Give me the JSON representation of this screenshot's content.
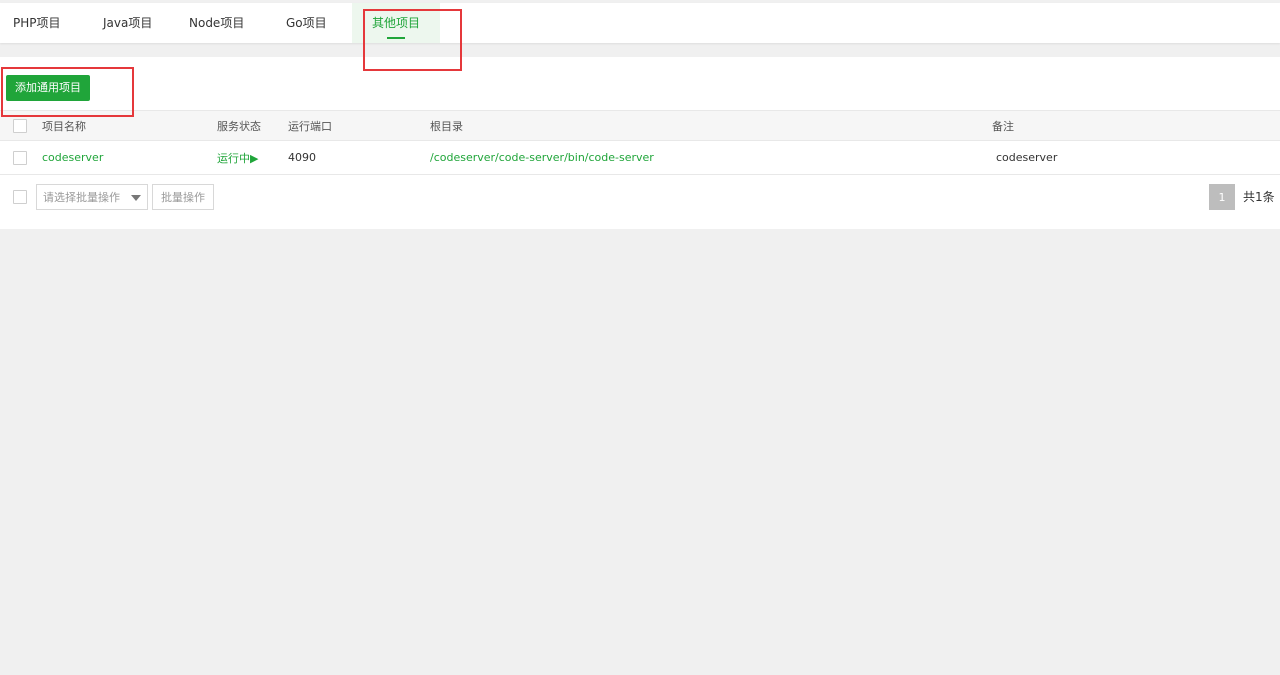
{
  "tabs": [
    {
      "label": "PHP项目",
      "active": false
    },
    {
      "label": "Java项目",
      "active": false
    },
    {
      "label": "Node项目",
      "active": false
    },
    {
      "label": "Go项目",
      "active": false
    },
    {
      "label": "其他项目",
      "active": true
    }
  ],
  "toolbar": {
    "add_label": "添加通用项目"
  },
  "table": {
    "headers": {
      "name": "项目名称",
      "status": "服务状态",
      "port": "运行端口",
      "root": "根目录",
      "remark": "备注"
    },
    "rows": [
      {
        "name": "codeserver",
        "status": "运行中▶",
        "port": "4090",
        "root": "/codeserver/code-server/bin/code-server",
        "remark": "codeserver"
      }
    ]
  },
  "footer": {
    "batch_placeholder": "请选择批量操作",
    "batch_button": "批量操作",
    "page_current": "1",
    "total_label": "共1条"
  },
  "colors": {
    "accent": "#20a53a",
    "annotation": "#e5383b"
  }
}
